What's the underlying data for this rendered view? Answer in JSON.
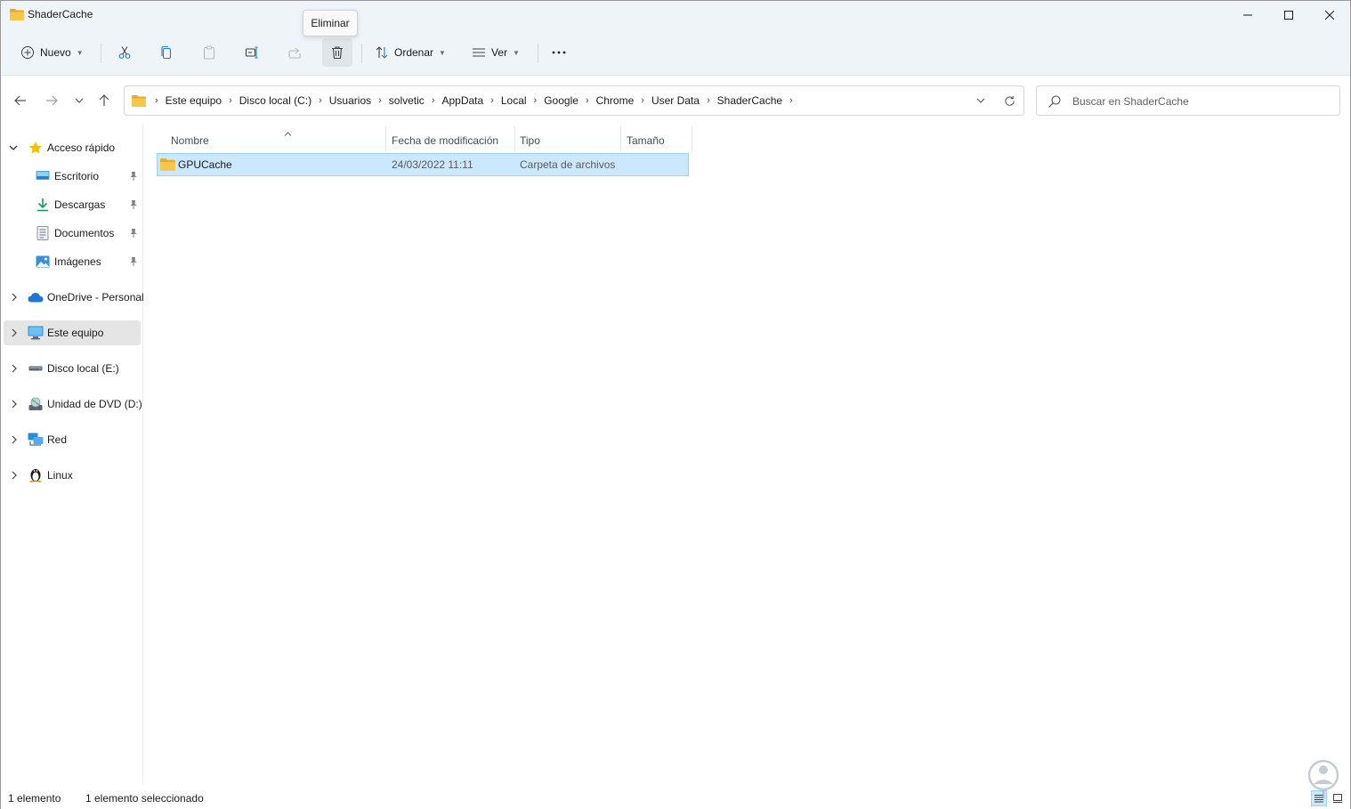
{
  "window": {
    "title": "ShaderCache",
    "controls": {
      "minimize": "minimize",
      "maximize": "maximize",
      "close": "close"
    }
  },
  "toolbar": {
    "new_label": "Nuevo",
    "sort_label": "Ordenar",
    "view_label": "Ver",
    "tooltip": "Eliminar"
  },
  "address": {
    "crumbs": [
      "Este equipo",
      "Disco local (C:)",
      "Usuarios",
      "solvetic",
      "AppData",
      "Local",
      "Google",
      "Chrome",
      "User Data",
      "ShaderCache"
    ]
  },
  "search": {
    "placeholder": "Buscar en ShaderCache"
  },
  "sidebar": {
    "quick_access": "Acceso rápido",
    "pinned": [
      "Escritorio",
      "Descargas",
      "Documentos",
      "Imágenes"
    ],
    "items": [
      "OneDrive - Personal",
      "Este equipo",
      "Disco local (E:)",
      "Unidad de DVD (D:)",
      "Red",
      "Linux"
    ]
  },
  "columns": {
    "name": "Nombre",
    "modified": "Fecha de modificación",
    "type": "Tipo",
    "size": "Tamaño"
  },
  "files": [
    {
      "name": "GPUCache",
      "modified": "24/03/2022 11:11",
      "type": "Carpeta de archivos",
      "size": ""
    }
  ],
  "status": {
    "count": "1 elemento",
    "selected": "1 elemento seleccionado"
  },
  "colors": {
    "accent": "#0067c0",
    "selection": "#cce8ff",
    "folder": "#f8c74a",
    "chrome_bg": "#eff4f9"
  }
}
